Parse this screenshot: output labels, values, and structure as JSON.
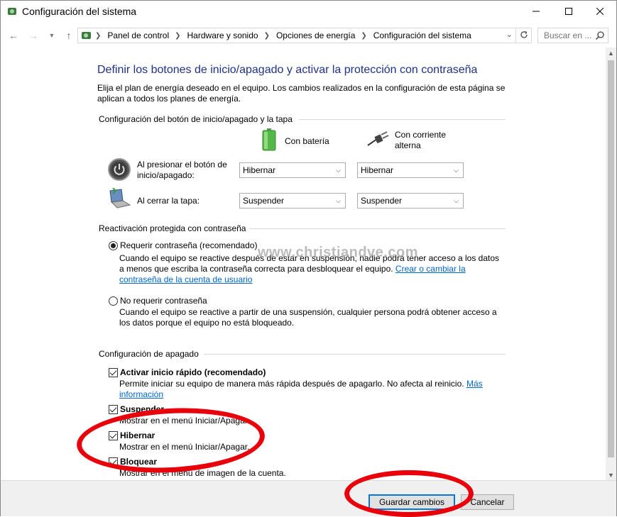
{
  "window": {
    "title": "Configuración del sistema"
  },
  "nav": {
    "breadcrumbs": [
      "Panel de control",
      "Hardware y sonido",
      "Opciones de energía",
      "Configuración del sistema"
    ],
    "search_placeholder": "Buscar en ..."
  },
  "page": {
    "heading": "Definir los botones de inicio/apagado y activar la protección con contraseña",
    "intro": "Elija el plan de energía deseado en el equipo. Los cambios realizados en la configuración de esta página se aplican a todos los planes de energía."
  },
  "power_buttons": {
    "section_title": "Configuración del botón de inicio/apagado y la tapa",
    "col_battery": "Con batería",
    "col_ac": "Con corriente alterna",
    "rows": [
      {
        "label": "Al presionar el botón de inicio/apagado:",
        "battery": "Hibernar",
        "ac": "Hibernar"
      },
      {
        "label": "Al cerrar la tapa:",
        "battery": "Suspender",
        "ac": "Suspender"
      }
    ]
  },
  "password": {
    "section_title": "Reactivación protegida con contraseña",
    "require_label": "Requerir contraseña (recomendado)",
    "require_desc": "Cuando el equipo se reactive después de estar en suspensión, nadie podrá tener acceso a los datos a menos que escriba la contraseña correcta para desbloquear el equipo.",
    "require_link": "Crear o cambiar la contraseña de la cuenta de usuario",
    "norequire_label": "No requerir contraseña",
    "norequire_desc": "Cuando el equipo se reactive a partir de una suspensión, cualquier persona podrá obtener acceso a los datos porque el equipo no está bloqueado."
  },
  "shutdown": {
    "section_title": "Configuración de apagado",
    "items": [
      {
        "label": "Activar inicio rápido (recomendado)",
        "desc": "Permite iniciar su equipo de manera más rápida después de apagarlo. No afecta al reinicio.",
        "link": "Más información"
      },
      {
        "label": "Suspender",
        "desc": "Mostrar en el menú Iniciar/Apagar."
      },
      {
        "label": "Hibernar",
        "desc": "Mostrar en el menú Iniciar/Apagar."
      },
      {
        "label": "Bloquear",
        "desc": "Mostrar en el menú de imagen de la cuenta."
      }
    ]
  },
  "watermark": "www.christiandve.com",
  "footer": {
    "save": "Guardar cambios",
    "cancel": "Cancelar"
  },
  "colors": {
    "heading": "#1e3287",
    "link": "#0066cc",
    "annotation": "#e8000b",
    "focus": "#0078d7"
  }
}
